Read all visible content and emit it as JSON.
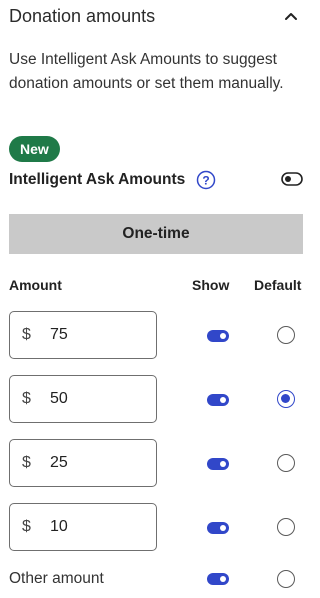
{
  "header": {
    "title": "Donation amounts"
  },
  "description": "Use Intelligent Ask Amounts to suggest donation amounts or set them manually.",
  "badge": {
    "label": "New",
    "color": "#1f7a48"
  },
  "intelligent_ask": {
    "label": "Intelligent Ask Amounts",
    "enabled": false
  },
  "tab": {
    "label": "One-time"
  },
  "columns": {
    "amount": "Amount",
    "show": "Show",
    "default": "Default"
  },
  "currency_symbol": "$",
  "amounts": [
    {
      "value": "75",
      "show": true,
      "default": false
    },
    {
      "value": "50",
      "show": true,
      "default": true
    },
    {
      "value": "25",
      "show": true,
      "default": false
    },
    {
      "value": "10",
      "show": true,
      "default": false
    }
  ],
  "other_amount": {
    "label": "Other amount",
    "show": true,
    "default": false
  },
  "colors": {
    "accent": "#3147c9",
    "tab_bg": "#c9c9c9"
  }
}
